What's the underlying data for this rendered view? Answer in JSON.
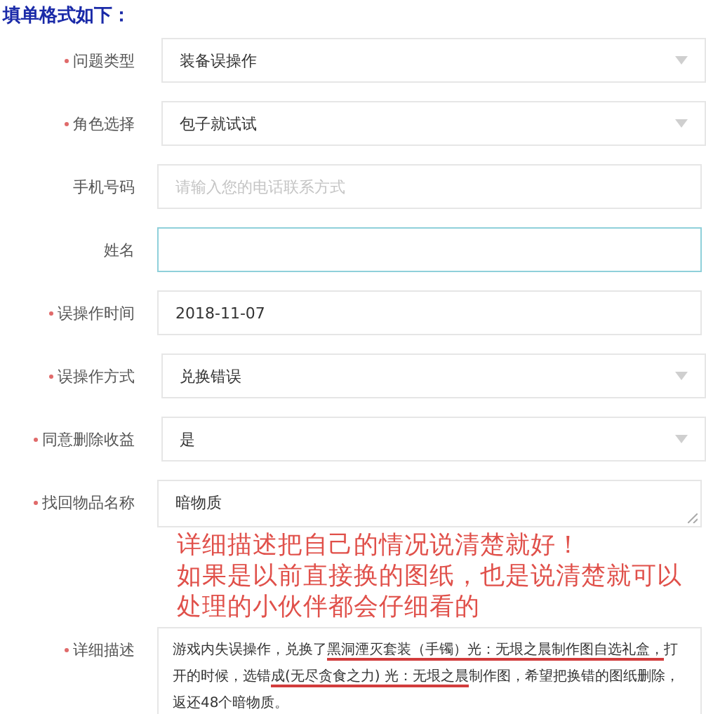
{
  "heading": "填单格式如下：",
  "fields": [
    {
      "label": "问题类型",
      "required": true,
      "kind": "select",
      "value": "装备误操作"
    },
    {
      "label": "角色选择",
      "required": true,
      "kind": "select",
      "value": "包子就试试"
    },
    {
      "label": "手机号码",
      "required": false,
      "kind": "input",
      "placeholder": "请输入您的电话联系方式"
    },
    {
      "label": "姓名",
      "required": false,
      "kind": "input",
      "focused": true
    },
    {
      "label": "误操作时间",
      "required": true,
      "kind": "input",
      "value": "2018-11-07"
    },
    {
      "label": "误操作方式",
      "required": true,
      "kind": "select",
      "value": "兑换错误"
    },
    {
      "label": "同意删除收益",
      "required": true,
      "kind": "select",
      "value": "是"
    },
    {
      "label": "找回物品名称",
      "required": true,
      "kind": "textarea",
      "value": "暗物质"
    },
    {
      "label": "详细描述",
      "required": true,
      "kind": "rich_textarea",
      "segments": [
        {
          "text": "游戏内失误操作，兑换了",
          "underlined": false
        },
        {
          "text": "黑洞湮灭套装（手镯）光：无垠之晨制作图自选礼盒，",
          "underlined": true
        },
        {
          "text": "打开的时候，选错",
          "underlined": false
        },
        {
          "text": "成(无尽贪食之力) 光：无垠之晨",
          "underlined": true
        },
        {
          "text": "制作图，希望把换错的图纸删除，返还48个暗物质。",
          "underlined": false
        }
      ]
    }
  ],
  "annotation": [
    "详细描述把自己的情况说清楚就好！",
    "如果是以前直接换的图纸，也是说清楚就可以",
    "处理的小伙伴都会仔细看的"
  ]
}
